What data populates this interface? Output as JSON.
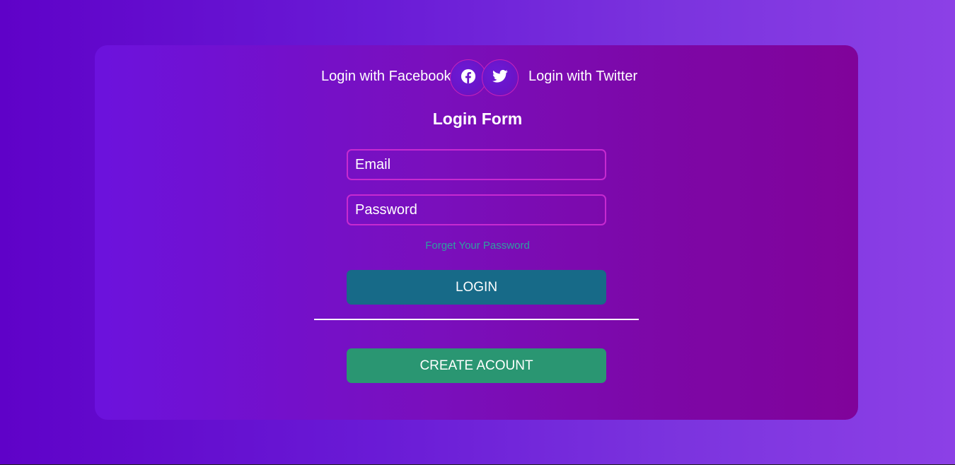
{
  "social": {
    "facebook_label": "Login with Facebook",
    "twitter_label": "Login with Twitter",
    "facebook_icon": "facebook-icon",
    "twitter_icon": "twitter-icon"
  },
  "form": {
    "title": "Login Form",
    "email_placeholder": "Email",
    "password_placeholder": "Password",
    "forgot_label": "Forget Your Password",
    "login_label": "LOGIN",
    "create_label": "CREATE ACOUNT"
  },
  "colors": {
    "login_button": "#176a88",
    "create_button": "#2a9672",
    "input_border": "#c72ad0",
    "forgot_link": "#2fa0a0"
  }
}
